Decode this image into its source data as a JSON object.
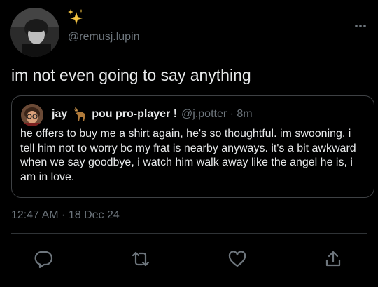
{
  "tweet": {
    "handle": "@remusj.lupin",
    "text": "im not even going to say anything",
    "timestamp": "12:47 AM · 18 Dec 24",
    "quoted": {
      "name_before": "jay",
      "name_after": "pou pro-player !",
      "handle_time": "@j.potter · 8m",
      "text": "he offers to buy me a shirt again, he's so thoughtful. im swooning. i tell him not to worry bc my frat is nearby anyways. it's a bit awkward when we say goodbye, i watch him walk away like the angel he is, i am in love."
    }
  },
  "icons": {
    "more": "more-icon",
    "reply": "reply-icon",
    "retweet": "retweet-icon",
    "like": "like-icon",
    "share": "share-icon"
  },
  "colors": {
    "background": "#000000",
    "text": "#e7e9ea",
    "muted": "#6e767d",
    "border": "#3e4144",
    "sparkle": "#f5c542"
  }
}
